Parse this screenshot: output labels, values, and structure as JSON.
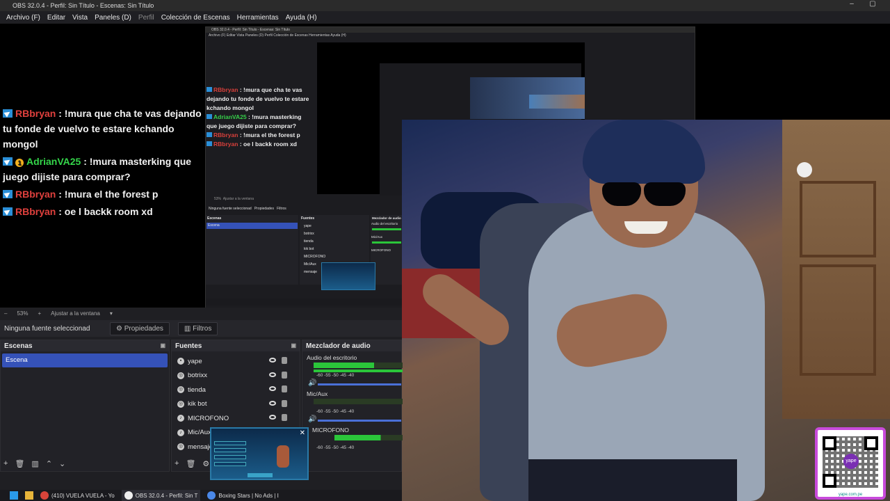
{
  "window": {
    "title": "OBS 32.0.4 - Perfil: Sin Título - Escenas: Sin Título",
    "minimize": "–",
    "maximize": "▢"
  },
  "menu": {
    "archivo": "Archivo (F)",
    "editar": "Editar",
    "vista": "Vista",
    "paneles": "Paneles (D)",
    "perfil": "Perfil",
    "coleccion": "Colección de Escenas",
    "herramientas": "Herramientas",
    "ayuda": "Ayuda (H)"
  },
  "chat": [
    {
      "user": "RBbryan",
      "message": ": !mura que cha te vas dejando tu fonde de vuelvo te estare kchando mongol"
    },
    {
      "user": "AdrianVA25",
      "message": ": !mura masterking que juego dijiste para comprar?"
    },
    {
      "user": "RBbryan",
      "message": ": !mura el the forest p"
    },
    {
      "user": "RBbryan",
      "message": ": oe l backk room xd"
    }
  ],
  "sub_badge": "1",
  "nested": {
    "title": "OBS 32.0.4 - Perfil: Sin Título - Escenas: Sin Título",
    "menu": "Archivo (F)   Editar   Vista   Paneles (D)   Perfil   Colección de Escenas   Herramientas   Ayuda (H)",
    "none_selected": "Ninguna fuente seleccionad",
    "properties": "Propiedades",
    "filters": "Filtros",
    "scenes": "Escenas",
    "scene": "Escena",
    "sources": "Fuentes",
    "mixer": "Mezclador de audio",
    "zoom": "53%",
    "fit": "Ajustar a la ventana",
    "desktop_audio": "Audio del escritorio",
    "mic": "Mic/Aux",
    "source_items": [
      "yape",
      "botrixx",
      "tienda",
      "kik bot",
      "MICROFONO",
      "Mic/Aux",
      "mensaje"
    ],
    "microfono": "MICROFONO"
  },
  "controls": {
    "zoom": "53%",
    "fit": "Ajustar a la ventana",
    "none_selected": "Ninguna fuente seleccionad",
    "properties": "Propiedades",
    "filters": "Filtros"
  },
  "scenes": {
    "title": "Escenas",
    "items": [
      "Escena"
    ]
  },
  "sources": {
    "title": "Fuentes",
    "items": [
      "yape",
      "botrixx",
      "tienda",
      "kik bot",
      "MICROFONO",
      "Mic/Aux",
      "mensaje"
    ]
  },
  "mixer": {
    "title": "Mezclador de audio",
    "channels": [
      "Audio del escritorio",
      "Mic/Aux",
      "MICROFONO"
    ],
    "ticks": "-60  -55  -50  -45  -40"
  },
  "qr": {
    "logo": "yape",
    "caption": "yape.com.pe"
  },
  "taskbar": {
    "apps": [
      "(410) VUELA VUELA - Yo",
      "OBS 32.0.4 - Perfil: Sin T",
      "Boxing Stars | No Ads | I"
    ]
  },
  "colors": {
    "accent": "#3552b8",
    "chat_red": "#e0403d",
    "chat_green": "#34d64a",
    "meter_green": "#2bc63a",
    "qr_border": "#c84adb"
  }
}
